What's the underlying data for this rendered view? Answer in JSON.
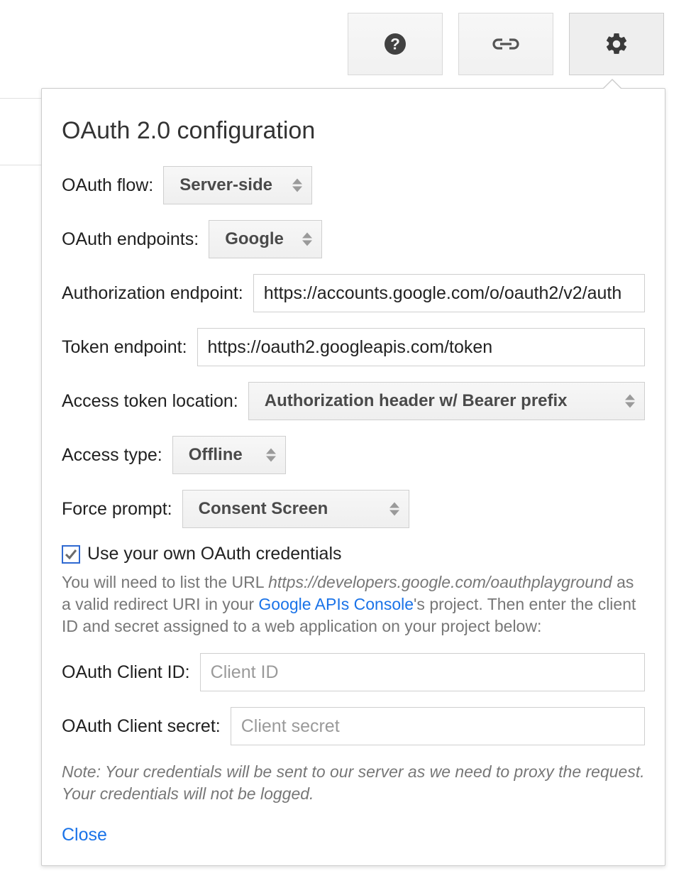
{
  "panel": {
    "title": "OAuth 2.0 configuration",
    "oauth_flow": {
      "label": "OAuth flow:",
      "value": "Server-side"
    },
    "oauth_endpoints": {
      "label": "OAuth endpoints:",
      "value": "Google"
    },
    "authorization_endpoint": {
      "label": "Authorization endpoint:",
      "value": "https://accounts.google.com/o/oauth2/v2/auth"
    },
    "token_endpoint": {
      "label": "Token endpoint:",
      "value": "https://oauth2.googleapis.com/token"
    },
    "access_token_location": {
      "label": "Access token location:",
      "value": "Authorization header w/ Bearer prefix"
    },
    "access_type": {
      "label": "Access type:",
      "value": "Offline"
    },
    "force_prompt": {
      "label": "Force prompt:",
      "value": "Consent Screen"
    },
    "use_own_creds": {
      "label": "Use your own OAuth credentials",
      "checked": true
    },
    "help": {
      "prefix": "You will need to list the URL ",
      "url": "https://developers.google.com/oauthplayground",
      "mid": " as a valid redirect URI in your ",
      "link": "Google APIs Console",
      "suffix": "'s project. Then enter the client ID and secret assigned to a web application on your project below:"
    },
    "client_id": {
      "label": "OAuth Client ID:",
      "placeholder": "Client ID",
      "value": ""
    },
    "client_secret": {
      "label": "OAuth Client secret:",
      "placeholder": "Client secret",
      "value": ""
    },
    "note": "Note: Your credentials will be sent to our server as we need to proxy the request. Your credentials will not be logged.",
    "close": "Close"
  }
}
